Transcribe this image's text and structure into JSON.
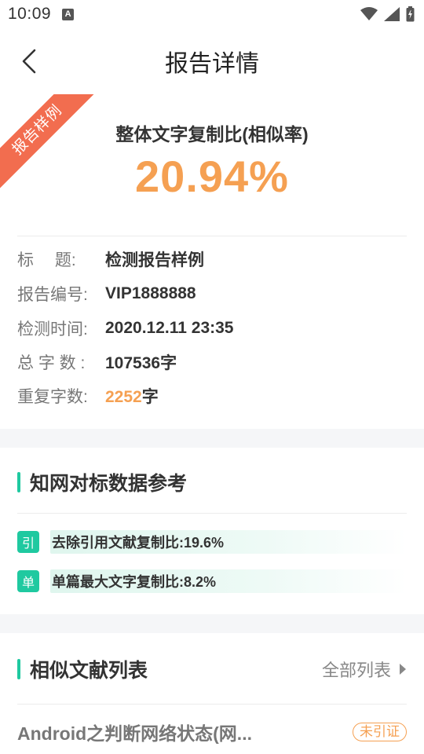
{
  "status_bar": {
    "time": "10:09",
    "notif_letter": "A"
  },
  "header": {
    "title": "报告详情"
  },
  "ribbon": {
    "text": "报告样例"
  },
  "overall": {
    "label": "整体文字复制比(相似率)",
    "value": "20.94%"
  },
  "info": [
    {
      "label": "标　 题:",
      "value": "检测报告样例"
    },
    {
      "label": "报告编号:",
      "value": "VIP1888888"
    },
    {
      "label": "检测时间:",
      "value": "2020.12.11 23:35"
    },
    {
      "label": "总 字 数 :",
      "value": "107536字"
    },
    {
      "label": "重复字数:",
      "value_number": "2252",
      "value_unit": "字"
    }
  ],
  "cnki": {
    "title": "知网对标数据参考",
    "rows": [
      {
        "badge": "引",
        "text": "去除引用文献复制比:19.6%"
      },
      {
        "badge": "单",
        "text": "单篇最大文字复制比:8.2%"
      }
    ]
  },
  "similar": {
    "title": "相似文献列表",
    "all_link": "全部列表",
    "items": [
      {
        "title": "Android之判断网络状态(网...",
        "badge": "未引证"
      }
    ]
  },
  "colors": {
    "accent": "#1fc9a0",
    "orange": "#f5a052",
    "ribbon": "#f26d4f"
  }
}
